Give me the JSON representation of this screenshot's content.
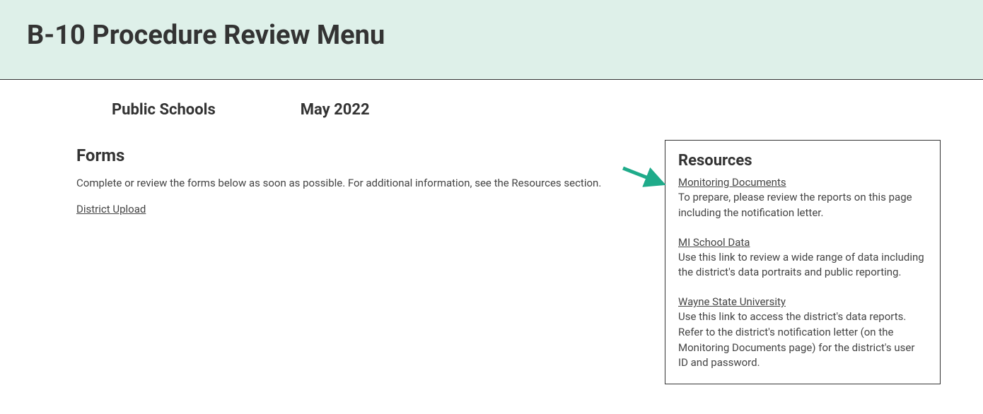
{
  "header": {
    "title": "B-10 Procedure Review Menu"
  },
  "subheader": {
    "org": "Public Schools",
    "date": "May 2022"
  },
  "forms": {
    "heading": "Forms",
    "instructions": "Complete or review the forms below as soon as possible. For additional information, see the Resources section.",
    "link_label": "District Upload"
  },
  "resources": {
    "heading": "Resources",
    "items": [
      {
        "link_label": "Monitoring Documents",
        "description": "To prepare, please review the reports on this page including the notification letter."
      },
      {
        "link_label": "MI School Data",
        "description": "Use this link to review a wide range of data including the district's data portraits and public reporting."
      },
      {
        "link_label": "Wayne State University",
        "description": "Use this link to access the district's data reports. Refer to the district's notification letter (on the Monitoring Documents page) for the district's user ID and password."
      }
    ]
  },
  "arrow": {
    "color": "#1fab8a"
  }
}
